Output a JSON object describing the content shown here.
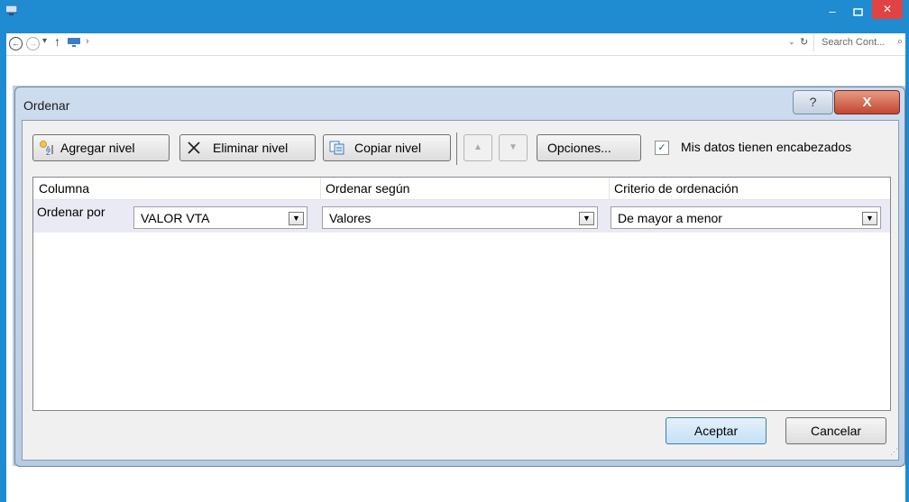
{
  "window": {
    "minimize": "–",
    "close": "✕"
  },
  "addressbar": {
    "back": "←",
    "forward": "→",
    "dropdown": "▾",
    "up": "↑",
    "separator": "›",
    "refresh": "↻",
    "history": "⌄",
    "search_placeholder": "Search Cont...",
    "search_icon": "⌕"
  },
  "dialog": {
    "title": "Ordenar",
    "help": "?",
    "close": "X",
    "toolbar": {
      "add_level": "Agregar nivel",
      "delete_level": "Eliminar nivel",
      "copy_level": "Copiar nivel",
      "move_up": "▲",
      "move_down": "▼",
      "options": "Opciones...",
      "headers_checkbox_label": "Mis datos tienen encabezados",
      "headers_checked": true
    },
    "columns": [
      "Columna",
      "Ordenar según",
      "Criterio de ordenación"
    ],
    "rows": [
      {
        "label": "Ordenar por",
        "column": "VALOR VTA",
        "sort_on": "Valores",
        "order": "De mayor a menor"
      }
    ],
    "ok": "Aceptar",
    "cancel": "Cancelar"
  },
  "colors": {
    "window_frame": "#1f8bd1",
    "dialog_background": "#f0f0f0",
    "selected_row": "#e9eaf3",
    "close_button": "#c24631"
  }
}
